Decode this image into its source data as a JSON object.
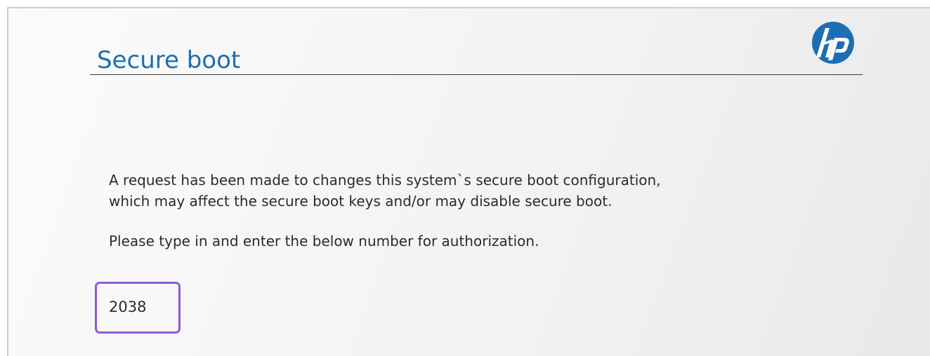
{
  "header": {
    "title": "Secure boot",
    "logo": "hp-logo-icon",
    "logo_color": "#1d6fb3"
  },
  "message": {
    "line1": "A request has been made to changes this system`s secure boot configuration,",
    "line2": "which may affect the secure boot keys and/or may disable secure boot.",
    "instruction": "Please type in and enter the below number for authorization."
  },
  "authorization": {
    "code": "2038",
    "highlight_color": "#8b5bd9"
  }
}
